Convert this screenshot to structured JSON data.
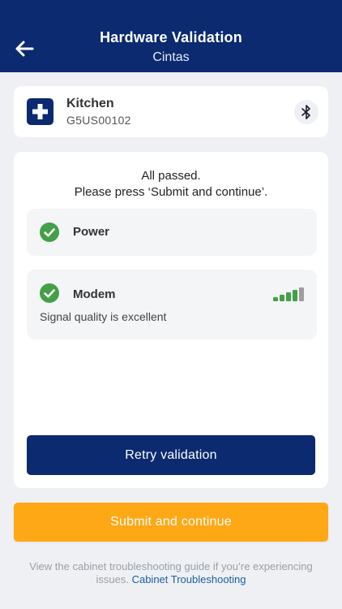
{
  "header": {
    "title": "Hardware Validation",
    "subtitle": "Cintas",
    "back_icon": "arrow-left-icon"
  },
  "device": {
    "name": "Kitchen",
    "serial": "G5US00102",
    "icon": "medical-cross-icon",
    "connection_icon": "bluetooth-icon"
  },
  "validation": {
    "status_line1": "All passed.",
    "status_line2": "Please press ‘Submit and continue’.",
    "items": [
      {
        "label": "Power",
        "status": "passed",
        "icon": "check-circle-icon"
      },
      {
        "label": "Modem",
        "status": "passed",
        "icon": "check-circle-icon",
        "detail": "Signal quality is excellent",
        "signal_level": 4
      }
    ],
    "retry_label": "Retry validation"
  },
  "submit_label": "Submit and continue",
  "footer": {
    "text": "View the cabinet troubleshooting guide if you’re experiencing issues.",
    "link_label": "Cabinet Troubleshooting"
  },
  "colors": {
    "primary": "#0b2a6f",
    "accent": "#ffa815",
    "success": "#43a047",
    "link": "#1d5fa6"
  }
}
